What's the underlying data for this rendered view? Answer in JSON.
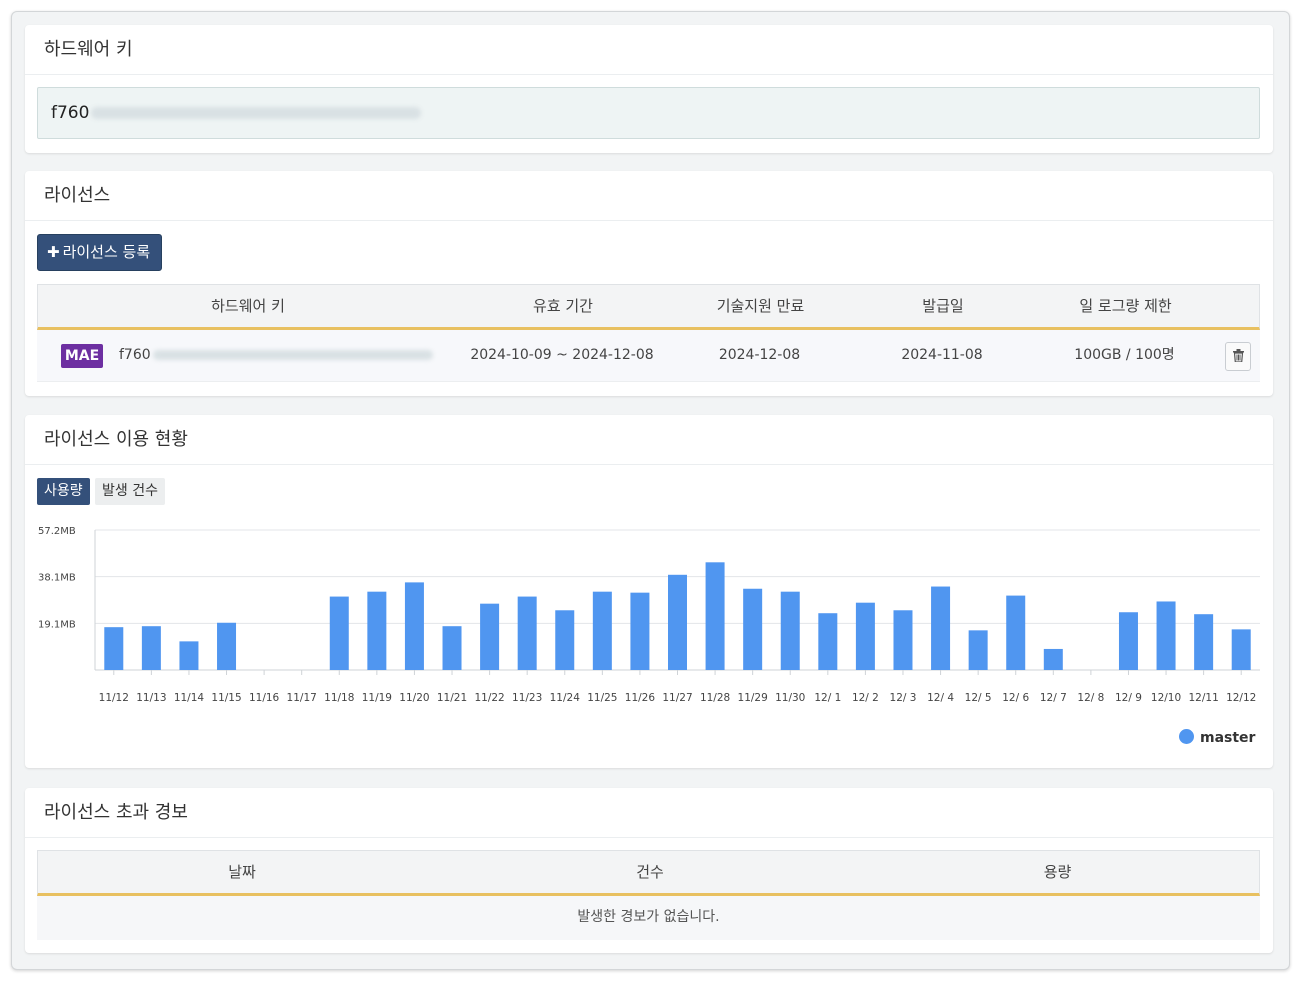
{
  "hardware_key_panel": {
    "title": "하드웨어 키",
    "key_prefix": "f760"
  },
  "license_panel": {
    "title": "라이선스",
    "add_button_label": "라이선스 등록",
    "columns": [
      "하드웨어 키",
      "유효 기간",
      "기술지원 만료",
      "발급일",
      "일 로그량 제한"
    ],
    "rows": [
      {
        "badge": "MAE",
        "hardware_key_prefix": "f760",
        "validity": "2024-10-09 ~ 2024-12-08",
        "support_expiry": "2024-12-08",
        "issued": "2024-11-08",
        "daily_limit": "100GB / 100명"
      }
    ]
  },
  "usage_panel": {
    "title": "라이선스 이용 현황",
    "tabs": [
      "사용량",
      "발생 건수"
    ],
    "active_tab": "사용량"
  },
  "chart_data": {
    "type": "bar",
    "categories": [
      "11/12",
      "11/13",
      "11/14",
      "11/15",
      "11/16",
      "11/17",
      "11/18",
      "11/19",
      "11/20",
      "11/21",
      "11/22",
      "11/23",
      "11/24",
      "11/25",
      "11/26",
      "11/27",
      "11/28",
      "11/29",
      "11/30",
      "12/ 1",
      "12/ 2",
      "12/ 3",
      "12/ 4",
      "12/ 5",
      "12/ 6",
      "12/ 7",
      "12/ 8",
      "12/ 9",
      "12/10",
      "12/11",
      "12/12"
    ],
    "series": [
      {
        "name": "master",
        "color": "#5096f0",
        "values": [
          17.5,
          17.9,
          11.7,
          19.3,
          0,
          0,
          30.0,
          32.0,
          35.8,
          17.9,
          27.1,
          30.0,
          24.4,
          32.0,
          31.6,
          38.9,
          44.0,
          33.2,
          32.0,
          23.2,
          27.5,
          24.4,
          34.1,
          16.2,
          30.4,
          8.6,
          0,
          23.6,
          28.0,
          22.8,
          16.6
        ]
      }
    ],
    "y_ticks": [
      "57.2MB",
      "38.1MB",
      "19.1MB"
    ],
    "ylim": [
      0,
      57.2
    ],
    "grid": true,
    "legend": "bottom-right",
    "title": "",
    "xlabel": "",
    "ylabel": ""
  },
  "alert_panel": {
    "title": "라이선스 초과 경보",
    "columns": [
      "날짜",
      "건수",
      "용량"
    ],
    "empty_message": "발생한 경보가 없습니다."
  }
}
